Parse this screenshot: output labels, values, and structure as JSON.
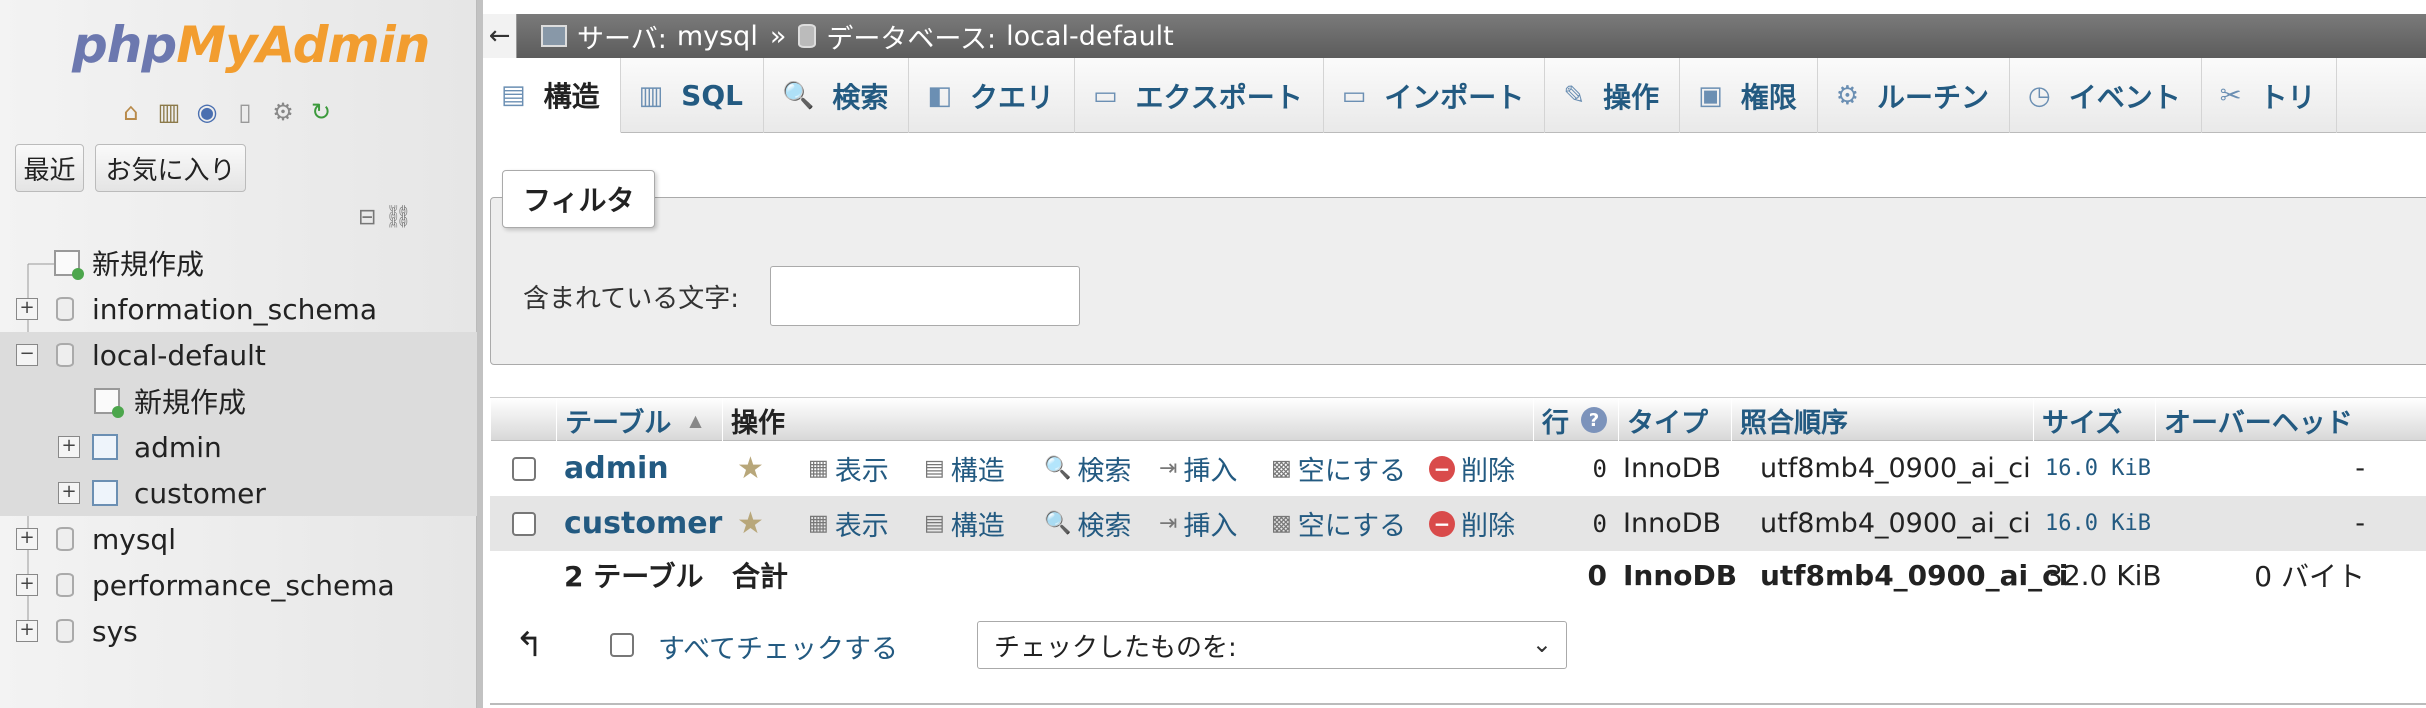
{
  "logo": {
    "php": "php",
    "myadmin": "MyAdmin"
  },
  "nav": {
    "icons": [
      "home-icon",
      "exit-icon",
      "docs-icon",
      "sql-docs-icon",
      "settings-icon",
      "reload-icon"
    ],
    "recent_label": "最近",
    "favorites_label": "お気に入り",
    "tree": [
      {
        "label": "新規作成",
        "type": "new",
        "level": 0
      },
      {
        "label": "information_schema",
        "type": "db",
        "level": 0
      },
      {
        "label": "local-default",
        "type": "db",
        "level": 0,
        "expanded": true
      },
      {
        "label": "新規作成",
        "type": "new",
        "level": 1
      },
      {
        "label": "admin",
        "type": "table",
        "level": 1
      },
      {
        "label": "customer",
        "type": "table",
        "level": 1
      },
      {
        "label": "mysql",
        "type": "db",
        "level": 0
      },
      {
        "label": "performance_schema",
        "type": "db",
        "level": 0
      },
      {
        "label": "sys",
        "type": "db",
        "level": 0
      }
    ]
  },
  "breadcrumb": {
    "back": "←",
    "server_label": "サーバ:",
    "server_name": "mysql",
    "separator": "»",
    "database_label": "データベース:",
    "database_name": "local-default"
  },
  "tabs": [
    {
      "label": "構造",
      "icon": "structure-icon",
      "glyph": "▤",
      "active": true
    },
    {
      "label": "SQL",
      "icon": "sql-icon",
      "glyph": "▥"
    },
    {
      "label": "検索",
      "icon": "search-icon",
      "glyph": "🔍"
    },
    {
      "label": "クエリ",
      "icon": "query-icon",
      "glyph": "◧"
    },
    {
      "label": "エクスポート",
      "icon": "export-icon",
      "glyph": "▭"
    },
    {
      "label": "インポート",
      "icon": "import-icon",
      "glyph": "▭"
    },
    {
      "label": "操作",
      "icon": "wrench-icon",
      "glyph": "✎"
    },
    {
      "label": "権限",
      "icon": "privileges-icon",
      "glyph": "▣"
    },
    {
      "label": "ルーチン",
      "icon": "routines-icon",
      "glyph": "⚙"
    },
    {
      "label": "イベント",
      "icon": "events-icon",
      "glyph": "◷"
    },
    {
      "label": "トリ",
      "icon": "triggers-icon",
      "glyph": "✂"
    }
  ],
  "filter": {
    "legend": "フィルタ",
    "label": "含まれている文字:",
    "value": ""
  },
  "table": {
    "headers": {
      "table": "テーブル",
      "action": "操作",
      "rows": "行",
      "type": "タイプ",
      "collation": "照合順序",
      "size": "サイズ",
      "overhead": "オーバーヘッド"
    },
    "actions": {
      "browse": "表示",
      "structure": "構造",
      "search": "検索",
      "insert": "挿入",
      "empty": "空にする",
      "drop": "削除"
    },
    "rows": [
      {
        "name": "admin",
        "rows": "0",
        "type": "InnoDB",
        "collation": "utf8mb4_0900_ai_ci",
        "size": "16.0 KiB",
        "overhead": "-"
      },
      {
        "name": "customer",
        "rows": "0",
        "type": "InnoDB",
        "collation": "utf8mb4_0900_ai_ci",
        "size": "16.0 KiB",
        "overhead": "-"
      }
    ],
    "total": {
      "count": "2 テーブル",
      "label": "合計",
      "rows": "0",
      "type": "InnoDB",
      "collation": "utf8mb4_0900_ai_ci",
      "size": "32.0 KiB",
      "overhead": "0 バイト"
    }
  },
  "footer": {
    "check_all": "すべてチェックする",
    "with_selected": "チェックしたものを:"
  }
}
